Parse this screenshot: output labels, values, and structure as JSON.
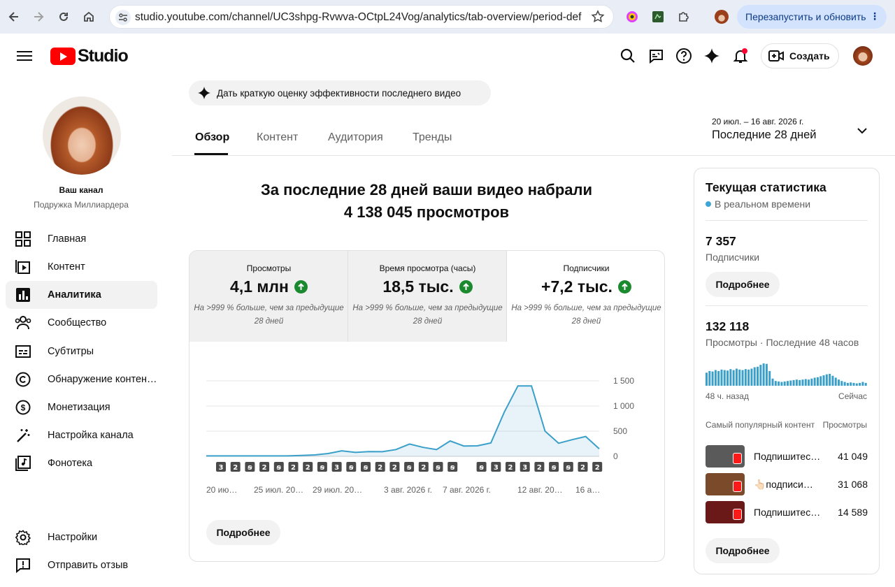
{
  "browser": {
    "url": "studio.youtube.com/channel/UC3shpg-Rvwva-OCtpL24Vog/analytics/tab-overview/period-def…",
    "relaunch_label": "Перезапустить и обновить",
    "icons": [
      "back-icon",
      "forward-icon",
      "reload-icon",
      "home-icon",
      "site-info-icon",
      "bookmark-star-icon",
      "extension-icon",
      "puzzle-icon",
      "profile-avatar"
    ]
  },
  "header": {
    "logo_text": "Studio",
    "create_label": "Создать"
  },
  "sidebar": {
    "your_channel": "Ваш канал",
    "channel_name": "Подружка Миллиардера",
    "items": [
      {
        "label": "Главная",
        "icon": "dashboard-icon"
      },
      {
        "label": "Контент",
        "icon": "content-icon"
      },
      {
        "label": "Аналитика",
        "icon": "analytics-icon",
        "active": true
      },
      {
        "label": "Сообщество",
        "icon": "community-icon"
      },
      {
        "label": "Субтитры",
        "icon": "subtitles-icon"
      },
      {
        "label": "Обнаружение контен…",
        "icon": "copyright-icon"
      },
      {
        "label": "Монетизация",
        "icon": "monetization-icon"
      },
      {
        "label": "Настройка канала",
        "icon": "customization-icon"
      },
      {
        "label": "Фонотека",
        "icon": "audio-library-icon"
      }
    ],
    "bottom": [
      {
        "label": "Настройки",
        "icon": "settings-icon"
      },
      {
        "label": "Отправить отзыв",
        "icon": "feedback-icon"
      }
    ]
  },
  "main": {
    "ai_prompt": "Дать краткую оценку эффективности последнего видео",
    "tabs": [
      "Обзор",
      "Контент",
      "Аудитория",
      "Тренды"
    ],
    "date_range": "20 июл. – 16 авг. 2026 г.",
    "period": "Последние 28 дней",
    "headline_line1": "За последние 28 дней ваши видео набрали",
    "headline_line2": "4 138 045 просмотров",
    "metrics": [
      {
        "title": "Просмотры",
        "value": "4,1 млн",
        "note": "На >999 % больше, чем за предыдущие 28 дней"
      },
      {
        "title": "Время просмотра (часы)",
        "value": "18,5 тыс.",
        "note": "На >999 % больше, чем за предыдущие 28 дней"
      },
      {
        "title": "Подписчики",
        "value": "+7,2 тыс.",
        "note": "На >999 % больше, чем за предыдущие 28 дней"
      }
    ],
    "more_label": "Подробнее"
  },
  "chart_data": {
    "type": "area",
    "x_labels": [
      "20 ию…",
      "25 июл. 20…",
      "29 июл. 20…",
      "3 авг. 2026 г.",
      "7 авг. 2026 г.",
      "12 авг. 20…",
      "16 а…"
    ],
    "y_ticks": [
      "1 500",
      "1 000",
      "500",
      "0"
    ],
    "ylim": [
      0,
      1500
    ],
    "color": "#3aa0c9",
    "values": [
      8,
      8,
      8,
      8,
      8,
      8,
      8,
      18,
      28,
      55,
      110,
      78,
      95,
      92,
      135,
      245,
      178,
      135,
      305,
      205,
      208,
      265,
      880,
      1400,
      1400,
      500,
      260,
      330,
      395,
      150
    ],
    "markers": [
      "3",
      "2",
      "s",
      "2",
      "s",
      "2",
      "2",
      "s",
      "3",
      "s",
      "s",
      "2",
      "2",
      "s",
      "2",
      "s",
      "s",
      "",
      "s",
      "3",
      "2",
      "3",
      "2",
      "s",
      "s",
      "2",
      "2"
    ]
  },
  "realtime": {
    "title": "Текущая статистика",
    "live_label": "В реальном времени",
    "subscribers_value": "7 357",
    "subscribers_label": "Подписчики",
    "more_label": "Подробнее",
    "views_value": "132 118",
    "views_label": "Просмотры · Последние 48 часов",
    "axis_left": "48 ч. назад",
    "axis_right": "Сейчас",
    "bars": [
      0.55,
      0.62,
      0.6,
      0.66,
      0.62,
      0.68,
      0.66,
      0.64,
      0.7,
      0.66,
      0.72,
      0.68,
      0.66,
      0.7,
      0.68,
      0.72,
      0.78,
      0.8,
      0.88,
      0.94,
      0.92,
      0.62,
      0.3,
      0.2,
      0.18,
      0.16,
      0.18,
      0.2,
      0.22,
      0.24,
      0.26,
      0.24,
      0.26,
      0.28,
      0.26,
      0.3,
      0.34,
      0.36,
      0.4,
      0.44,
      0.48,
      0.5,
      0.42,
      0.34,
      0.26,
      0.2,
      0.16,
      0.12,
      0.14,
      0.12,
      0.1,
      0.12,
      0.16,
      0.12
    ],
    "top_content_label": "Самый популярный контент",
    "top_views_label": "Просмотры",
    "videos": [
      {
        "title": "Подпишитес…",
        "views": "41 049",
        "thumb": "#5a5a5a"
      },
      {
        "title": "👆🏻подписи…",
        "views": "31 068",
        "thumb": "#7a4a2a"
      },
      {
        "title": "Подпишитес…",
        "views": "14 589",
        "thumb": "#6a1818"
      }
    ]
  }
}
